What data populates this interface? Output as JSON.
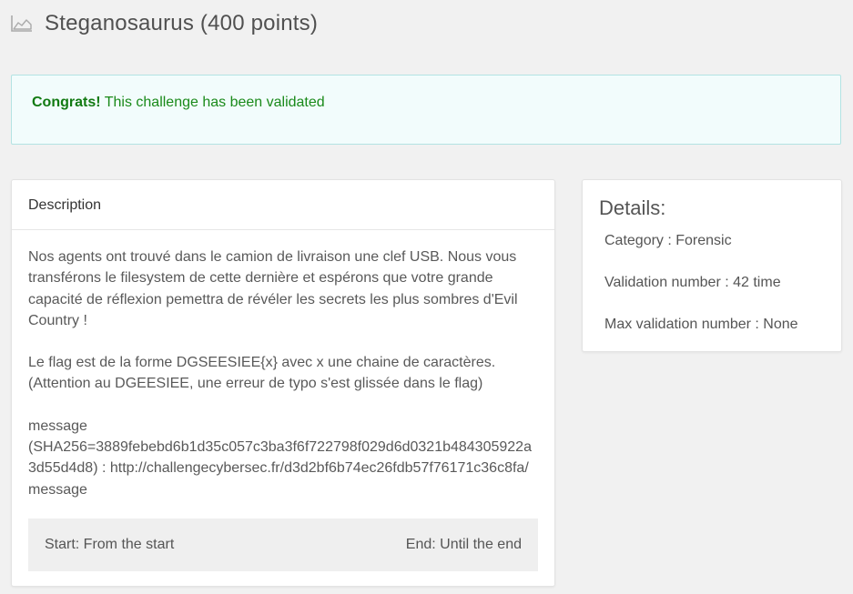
{
  "page": {
    "title": "Steganosaurus (400 points)",
    "icon": "area-chart-icon"
  },
  "alert": {
    "strong": "Congrats!",
    "text": " This challenge has been validated"
  },
  "description": {
    "header": "Description",
    "paragraphs": [
      "Nos agents ont trouvé dans le camion de livraison une clef USB. Nous vous transférons le filesystem de cette dernière et espérons que votre grande capacité de réflexion pemettra de révéler les secrets les plus sombres d'Evil Country !",
      "Le flag est de la forme DGSEESIEE{x} avec x une chaine de caractères. (Attention au DGEESIEE, une erreur de typo s'est glissée dans le flag)"
    ],
    "message_label": "message",
    "message_hash": "(SHA256=3889febebd6b1d35c057c3ba3f6f722798f029d6d0321b484305922a3d55d4d8)",
    "message_link": "http://challengecybersec.fr/d3d2bf6b74ec26fdb57f76171c36c8fa/message",
    "start": "Start: From the start",
    "end": "End: Until the end"
  },
  "details": {
    "title": "Details:",
    "category": "Category : Forensic",
    "validation": "Validation number : 42 time",
    "max_validation": "Max validation number : None"
  }
}
